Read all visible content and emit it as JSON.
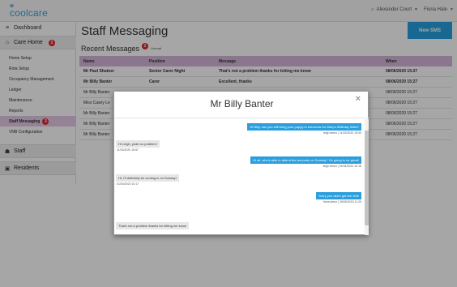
{
  "app": {
    "logo_mark": "≋",
    "logo_text": "coolcare",
    "brand_color": "#27a0e0"
  },
  "topbar": {
    "home_icon": "home-icon",
    "location": "Alexander Court",
    "user": "Fiona Hale"
  },
  "sidebar": {
    "dashboard": "Dashboard",
    "care_home": "Care Home",
    "care_home_badge": "3",
    "items": [
      {
        "label": "Home Setup"
      },
      {
        "label": "Rota Setup"
      },
      {
        "label": "Occupancy Management"
      },
      {
        "label": "Ledger"
      },
      {
        "label": "Maintenance"
      },
      {
        "label": "Reports"
      },
      {
        "label": "Staff Messaging",
        "badge": "3",
        "active": true
      },
      {
        "label": "VNB Configuration"
      }
    ],
    "staff": "Staff",
    "residents": "Residents"
  },
  "main": {
    "title": "Staff Messaging",
    "new_sms": "New SMS",
    "recent_title": "Recent Messages",
    "unread_count": "2",
    "unread_label": "Unread"
  },
  "table": {
    "headers": {
      "name": "Name",
      "position": "Position",
      "message": "Message",
      "when": "When"
    },
    "rows": [
      {
        "name": "Mr Paul Shatner",
        "position": "Senior Carer Night",
        "message": "That's not a problem thanks for letting me know",
        "when": "08/06/2020 15:27",
        "bold": true
      },
      {
        "name": "Mr Billy Banter",
        "position": "Carer",
        "message": "Excellent, thanks",
        "when": "08/06/2020 15:27",
        "bold": true
      },
      {
        "name": "Mr Billy Banter",
        "position": "",
        "message": "",
        "when": "08/06/2020 15:27",
        "bold": false
      },
      {
        "name": "Miss Casey Le",
        "position": "",
        "message": "",
        "when": "08/06/2020 15:27",
        "bold": false
      },
      {
        "name": "Mr Billy Banter",
        "position": "",
        "message": "",
        "when": "08/06/2020 15:27",
        "bold": false
      },
      {
        "name": "Mr Billy Banter",
        "position": "",
        "message": "",
        "when": "08/06/2020 15:27",
        "bold": false
      },
      {
        "name": "Mr Billy Banter",
        "position": "",
        "message": "",
        "when": "08/06/2020 15:27",
        "bold": false
      }
    ]
  },
  "modal": {
    "title": "Mr Billy Banter",
    "close": "×",
    "messages": [
      {
        "dir": "out",
        "text": "Hi Billy, can you still bring your puppy in tomorrow for Mary's Birthday Wish?",
        "meta": "leigh.demo | 11/03/2020 15:00"
      },
      {
        "dir": "in",
        "text": "Hi Leigh, yeah no problem!",
        "meta": "11/03/2020 15:57"
      },
      {
        "dir": "out",
        "text": "Hi all, who's able to attend the tea party on Sunday? It's going to be great!",
        "meta": "leigh.demo | 01/04/2020 10:16"
      },
      {
        "dir": "in",
        "text": "Hi, I'll definitely be coming in on Sunday!",
        "meta": "01/04/2020 10:17"
      },
      {
        "dir": "out",
        "text": "Sorry you didn't get the 30th",
        "meta": "fiona.demo | 28/05/2020 11:29"
      },
      {
        "dir": "in",
        "text": "That's not a problem thanks for letting me know",
        "meta": ""
      }
    ]
  }
}
